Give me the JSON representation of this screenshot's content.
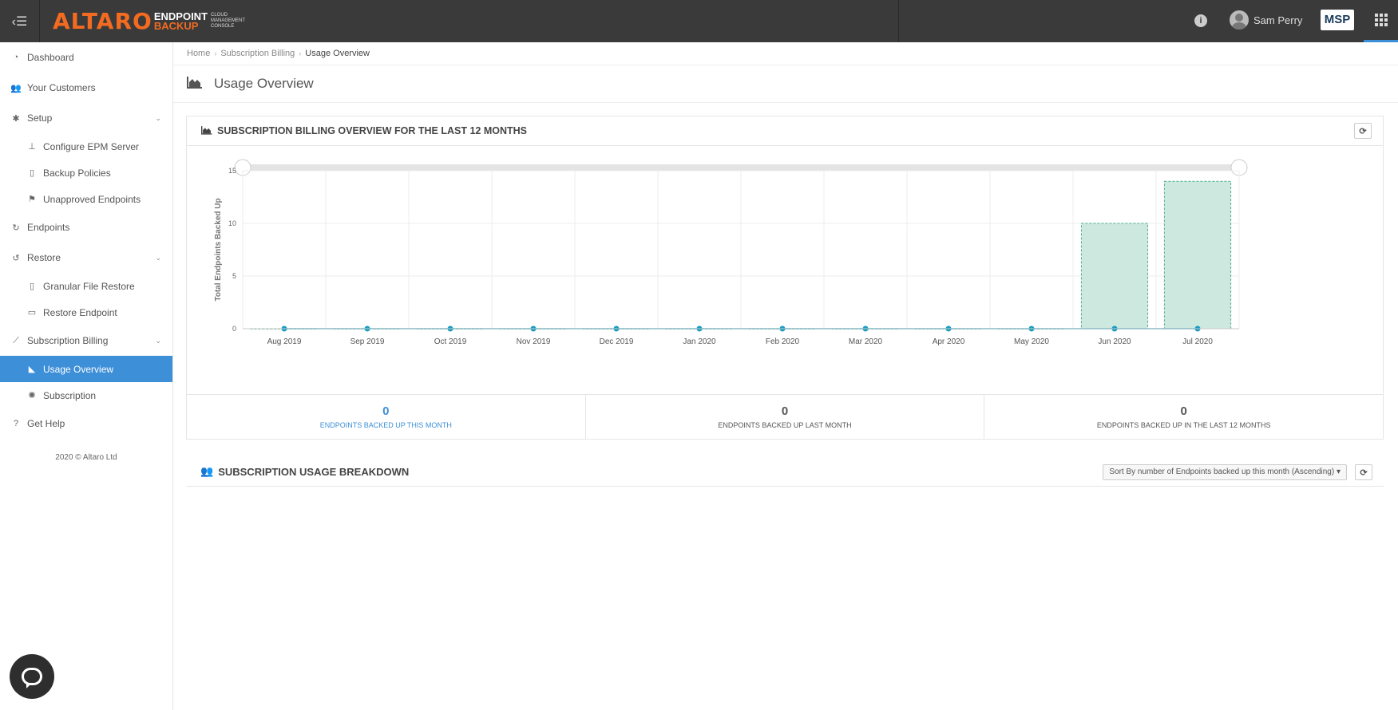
{
  "topbar": {
    "brand_main": "ALTARO",
    "brand_line1": "ENDPOINT",
    "brand_line2": "BACKUP",
    "brand_sub1": "CLOUD",
    "brand_sub2": "MANAGEMENT",
    "brand_sub3": "CONSOLE",
    "user_name": "Sam Perry",
    "msp_label": "MSP",
    "info_glyph": "i"
  },
  "sidebar": {
    "items": [
      {
        "label": "Dashboard",
        "icon": "dashboard-icon"
      },
      {
        "label": "Your Customers",
        "icon": "users-icon"
      },
      {
        "label": "Setup",
        "icon": "gear-icon"
      },
      {
        "label": "Configure EPM Server",
        "icon": "sitemap-icon"
      },
      {
        "label": "Backup Policies",
        "icon": "file-icon"
      },
      {
        "label": "Unapproved Endpoints",
        "icon": "flag-icon"
      },
      {
        "label": "Endpoints",
        "icon": "refresh-icon"
      },
      {
        "label": "Restore",
        "icon": "undo-icon"
      },
      {
        "label": "Granular File Restore",
        "icon": "file-icon"
      },
      {
        "label": "Restore Endpoint",
        "icon": "laptop-icon"
      },
      {
        "label": "Subscription Billing",
        "icon": "line-chart-icon"
      },
      {
        "label": "Usage Overview",
        "icon": "area-chart-icon"
      },
      {
        "label": "Subscription",
        "icon": "cog-icon"
      },
      {
        "label": "Get Help",
        "icon": "question-icon"
      }
    ],
    "copyright": "2020 © Altaro Ltd"
  },
  "breadcrumb": {
    "home": "Home",
    "section": "Subscription Billing",
    "current": "Usage Overview"
  },
  "page": {
    "title": "Usage Overview"
  },
  "overview": {
    "title": "SUBSCRIPTION BILLING OVERVIEW FOR THE LAST 12 MONTHS",
    "stats": [
      {
        "value": "0",
        "label": "ENDPOINTS BACKED UP THIS MONTH"
      },
      {
        "value": "0",
        "label": "ENDPOINTS BACKED UP LAST MONTH"
      },
      {
        "value": "0",
        "label": "ENDPOINTS BACKED UP IN THE LAST 12 MONTHS"
      }
    ]
  },
  "breakdown": {
    "title": "SUBSCRIPTION USAGE BREAKDOWN",
    "sort_label": "Sort By number of Endpoints backed up this month (Ascending)"
  },
  "colors": {
    "accent": "#3d8fd8",
    "brand_orange": "#f26b21",
    "bar_fill": "#cce8df",
    "bar_stroke": "#4fb08a",
    "line": "#1a9dc0"
  },
  "chart_data": {
    "type": "bar",
    "categories": [
      "Aug 2019",
      "Sep 2019",
      "Oct 2019",
      "Nov 2019",
      "Dec 2019",
      "Jan 2020",
      "Feb 2020",
      "Mar 2020",
      "Apr 2020",
      "May 2020",
      "Jun 2020",
      "Jul 2020"
    ],
    "series": [
      {
        "type": "bar",
        "values": [
          0,
          0,
          0,
          0,
          0,
          0,
          0,
          0,
          0,
          0,
          10,
          14
        ]
      },
      {
        "type": "line",
        "values": [
          0,
          0,
          0,
          0,
          0,
          0,
          0,
          0,
          0,
          0,
          0,
          0
        ]
      }
    ],
    "title": "",
    "xlabel": "",
    "ylabel": "Total Endpoints Backed Up",
    "ylim": [
      0,
      15
    ],
    "yticks": [
      0,
      5,
      10,
      15
    ],
    "grid": true,
    "legend": "none"
  }
}
